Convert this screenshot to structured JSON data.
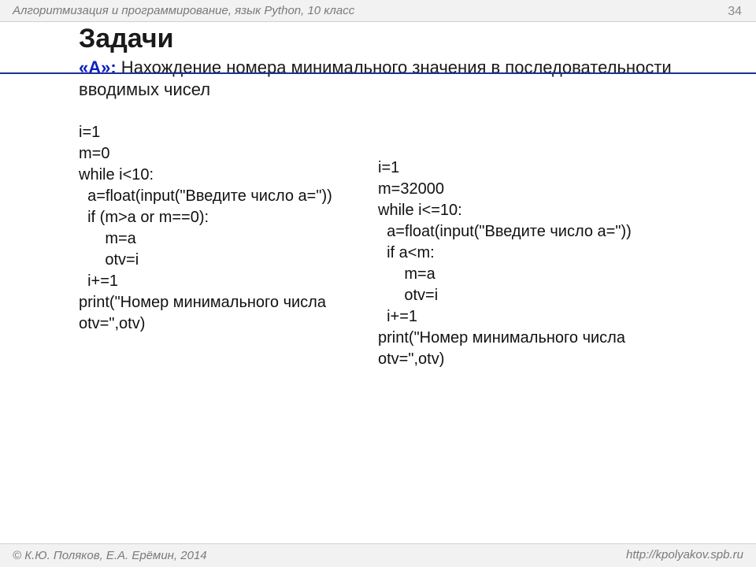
{
  "header": {
    "course": "Алгоритмизация и программирование, язык Python, 10 класс",
    "page_number": "34"
  },
  "title": "Задачи",
  "task": {
    "label": "«A»:",
    "text": " Нахождение номера минимального значения в последовательности вводимых чисел"
  },
  "code": {
    "left": "i=1\nm=0\nwhile i<10:\n  a=float(input(\"Введите число a=\"))\n  if (m>a or m==0):\n      m=a\n      otv=i\n  i+=1\nprint(\"Номер минимального числа\notv=\",otv)",
    "right": "i=1\nm=32000\nwhile i<=10:\n  a=float(input(\"Введите число a=\"))\n  if a<m:\n      m=a\n      otv=i\n  i+=1\nprint(\"Номер минимального числа\notv=\",otv)"
  },
  "footer": {
    "copyright_symbol": "©",
    "authors": " К.Ю. Поляков, Е.А. Ерёмин, 2014",
    "url": "http://kpolyakov.spb.ru"
  }
}
